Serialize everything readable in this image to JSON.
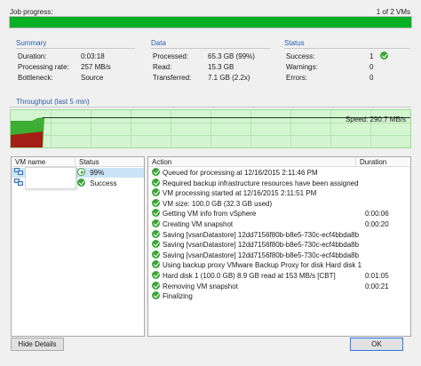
{
  "job_progress": {
    "label": "Job progress:",
    "count": "1 of 2 VMs",
    "fraction": 1.0
  },
  "summary": {
    "title": "Summary",
    "rows": [
      {
        "label": "Duration:",
        "value": "0:03:18"
      },
      {
        "label": "Processing rate:",
        "value": "257 MB/s"
      },
      {
        "label": "Bottleneck:",
        "value": "Source"
      }
    ]
  },
  "data_section": {
    "title": "Data",
    "rows": [
      {
        "label": "Processed:",
        "value": "65.3 GB (99%)"
      },
      {
        "label": "Read:",
        "value": "15.3 GB"
      },
      {
        "label": "Transferred:",
        "value": "7.1 GB (2.2x)"
      }
    ]
  },
  "status_section": {
    "title": "Status",
    "rows": [
      {
        "label": "Success:",
        "value": "1"
      },
      {
        "label": "Warnings:",
        "value": "0"
      },
      {
        "label": "Errors:",
        "value": "0"
      }
    ]
  },
  "throughput": {
    "title": "Throughput (last 5 min)",
    "speed": "Speed: 290.7 MB/s"
  },
  "vm_table": {
    "col_name": "VM name",
    "col_status": "Status",
    "rows": [
      {
        "name": "l",
        "status": "99%",
        "icon": "play-icon"
      },
      {
        "name": "l",
        "status": "Success",
        "icon": "success-icon"
      }
    ]
  },
  "log_table": {
    "col_action": "Action",
    "col_duration": "Duration",
    "rows": [
      {
        "action": "Queued for processing at 12/16/2015 2:11:46 PM",
        "duration": ""
      },
      {
        "action": "Required backup infrastructure resources have been assigned",
        "duration": ""
      },
      {
        "action": "VM processing started at 12/16/2015 2:11:51 PM",
        "duration": ""
      },
      {
        "action": "VM size: 100.0 GB (32.3 GB used)",
        "duration": ""
      },
      {
        "action": "Getting VM info from vSphere",
        "duration": "0:00:06"
      },
      {
        "action": "Creating VM snapshot",
        "duration": "0:00:20"
      },
      {
        "action": "Saving [vsanDatastore] 12dd7156f80b-b8e5-730c-ecf4bbda8b",
        "duration": ""
      },
      {
        "action": "Saving [vsanDatastore] 12dd7156f80b-b8e5-730c-ecf4bbda8b",
        "duration": ""
      },
      {
        "action": "Saving [vsanDatastore] 12dd7156f80b-b8e5-730c-ecf4bbda8b",
        "duration": ""
      },
      {
        "action": "Using backup proxy VMware Backup Proxy for disk Hard disk 1",
        "duration": ""
      },
      {
        "action": "Hard disk 1 (100.0 GB) 8.9 GB read at 153 MB/s [CBT]",
        "duration": "0:01:05"
      },
      {
        "action": "Removing VM snapshot",
        "duration": "0:00:21"
      },
      {
        "action": "Finalizing",
        "duration": ""
      }
    ]
  },
  "buttons": {
    "hide_details": "Hide Details",
    "ok": "OK"
  },
  "colors": {
    "progress": "#06b025",
    "accent": "#2a5ea8",
    "success": "#3ca436",
    "chart_green": "#3cae34",
    "chart_red": "#a42016"
  }
}
